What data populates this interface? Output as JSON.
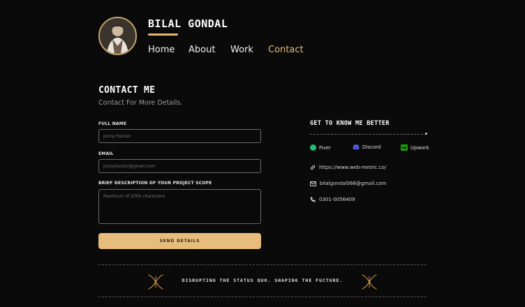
{
  "header": {
    "name": "BILAL GONDAL",
    "nav": [
      "Home",
      "About",
      "Work",
      "Contact"
    ],
    "active_nav": "Contact"
  },
  "contact": {
    "title": "CONTACT ME",
    "subtitle": "Contact For More Details.",
    "fields": {
      "full_name": {
        "label": "FULL NAME",
        "placeholder": "Jonny Hackor"
      },
      "email": {
        "label": "EMAIL",
        "placeholder": "jonnyhackor@gmail.com"
      },
      "description": {
        "label": "BRIEF DESCRIPTION OF YOUR PROJECT SCOPE",
        "placeholder": "Maximum of 2000 characters"
      }
    },
    "send_label": "SEND DETAILS"
  },
  "sidebar": {
    "title": "GET TO KNOW ME BETTER",
    "socials": [
      {
        "label": "Fiver",
        "icon": "fiverr-icon",
        "color": "#1dbf73"
      },
      {
        "label": "Discord",
        "icon": "discord-icon",
        "color": "#5865f2"
      },
      {
        "label": "Upwork",
        "icon": "upwork-icon",
        "color": "#14a800"
      }
    ],
    "website": "https://www.web-metric.co/",
    "email": "bilalgondal066@gmail.com",
    "phone": "0301-0056409"
  },
  "footer": {
    "motto": "DISRUPTING THE STATUS QUO. SHAPING THE FUCTURE."
  },
  "colors": {
    "accent": "#e8b96f",
    "background": "#0a0a0a"
  }
}
